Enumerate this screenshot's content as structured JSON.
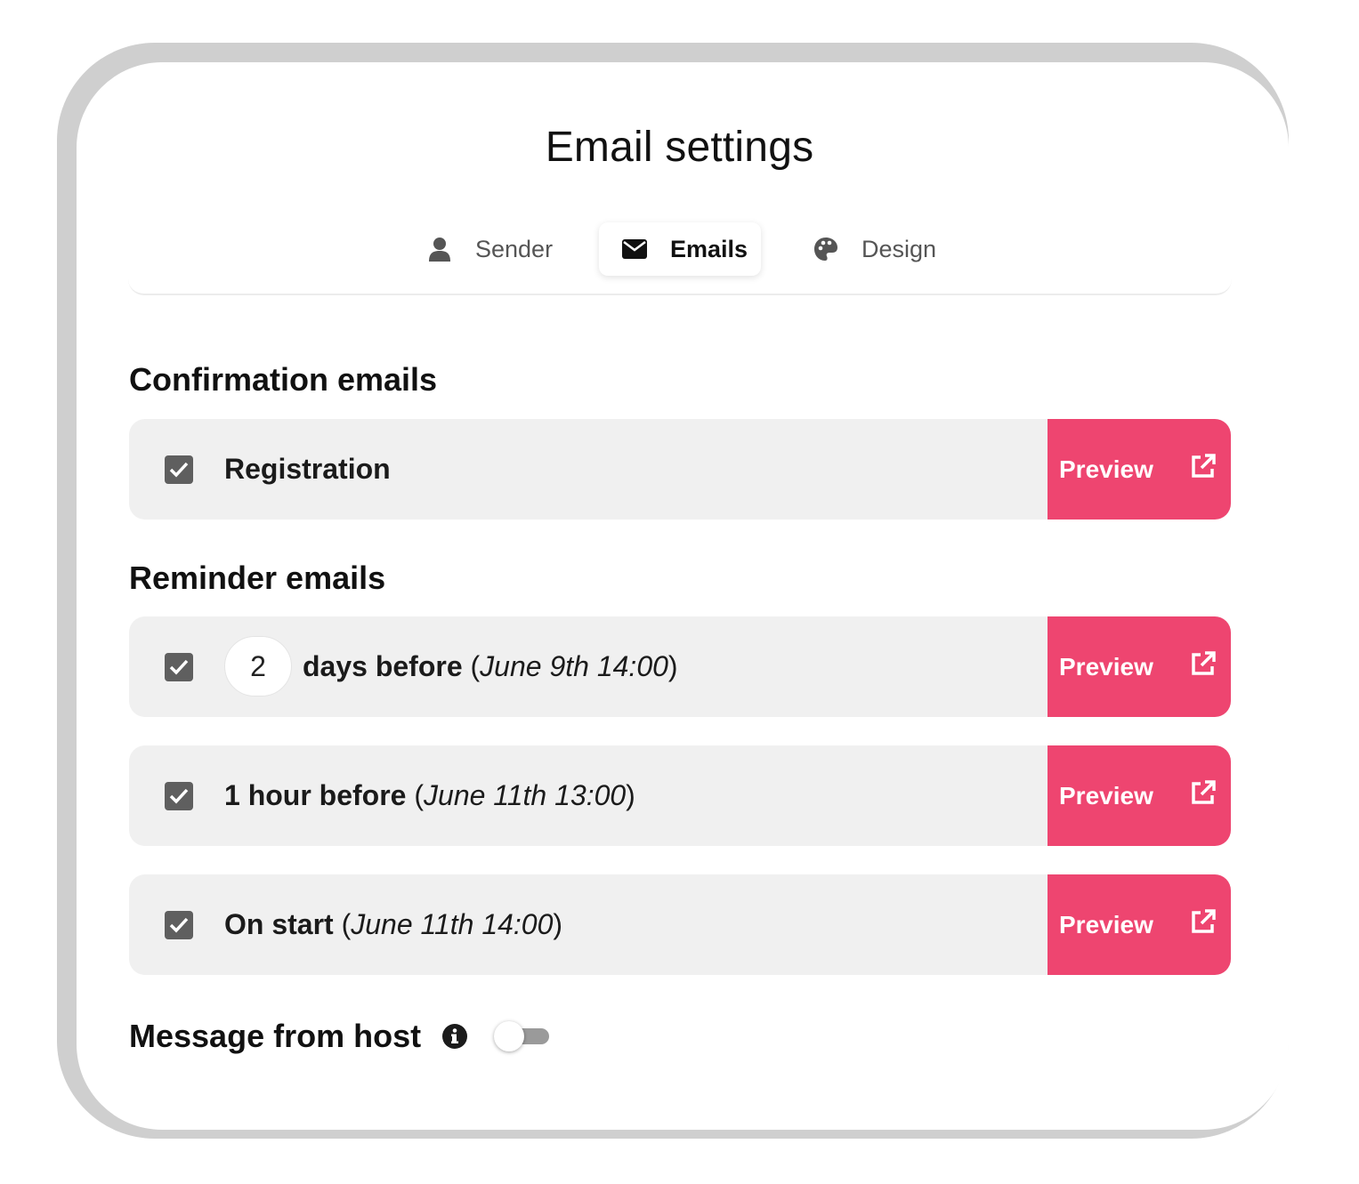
{
  "title": "Email settings",
  "tabs": [
    {
      "label": "Sender",
      "icon": "user-icon",
      "active": false
    },
    {
      "label": "Emails",
      "icon": "envelope-icon",
      "active": true
    },
    {
      "label": "Design",
      "icon": "palette-icon",
      "active": false
    }
  ],
  "confirmation": {
    "heading": "Confirmation emails",
    "rows": [
      {
        "checked": true,
        "label": "Registration",
        "preview_label": "Preview"
      }
    ]
  },
  "reminders": {
    "heading": "Reminder emails",
    "rows": [
      {
        "checked": true,
        "value": "2",
        "label": "days before",
        "open_paren": "(",
        "date": "June 9th 14:00",
        "close_paren": ")",
        "preview_label": "Preview"
      },
      {
        "checked": true,
        "label": "1 hour before",
        "open_paren": "(",
        "date": "June 11th 13:00",
        "close_paren": ")",
        "preview_label": "Preview"
      },
      {
        "checked": true,
        "label": "On start",
        "open_paren": "(",
        "date": "June 11th 14:00",
        "close_paren": ")",
        "preview_label": "Preview"
      }
    ]
  },
  "host_message": {
    "label": "Message from host",
    "enabled": false
  },
  "colors": {
    "accent": "#ee4570",
    "row_bg": "#f0f0f0",
    "checkbox": "#5f5f5f"
  }
}
